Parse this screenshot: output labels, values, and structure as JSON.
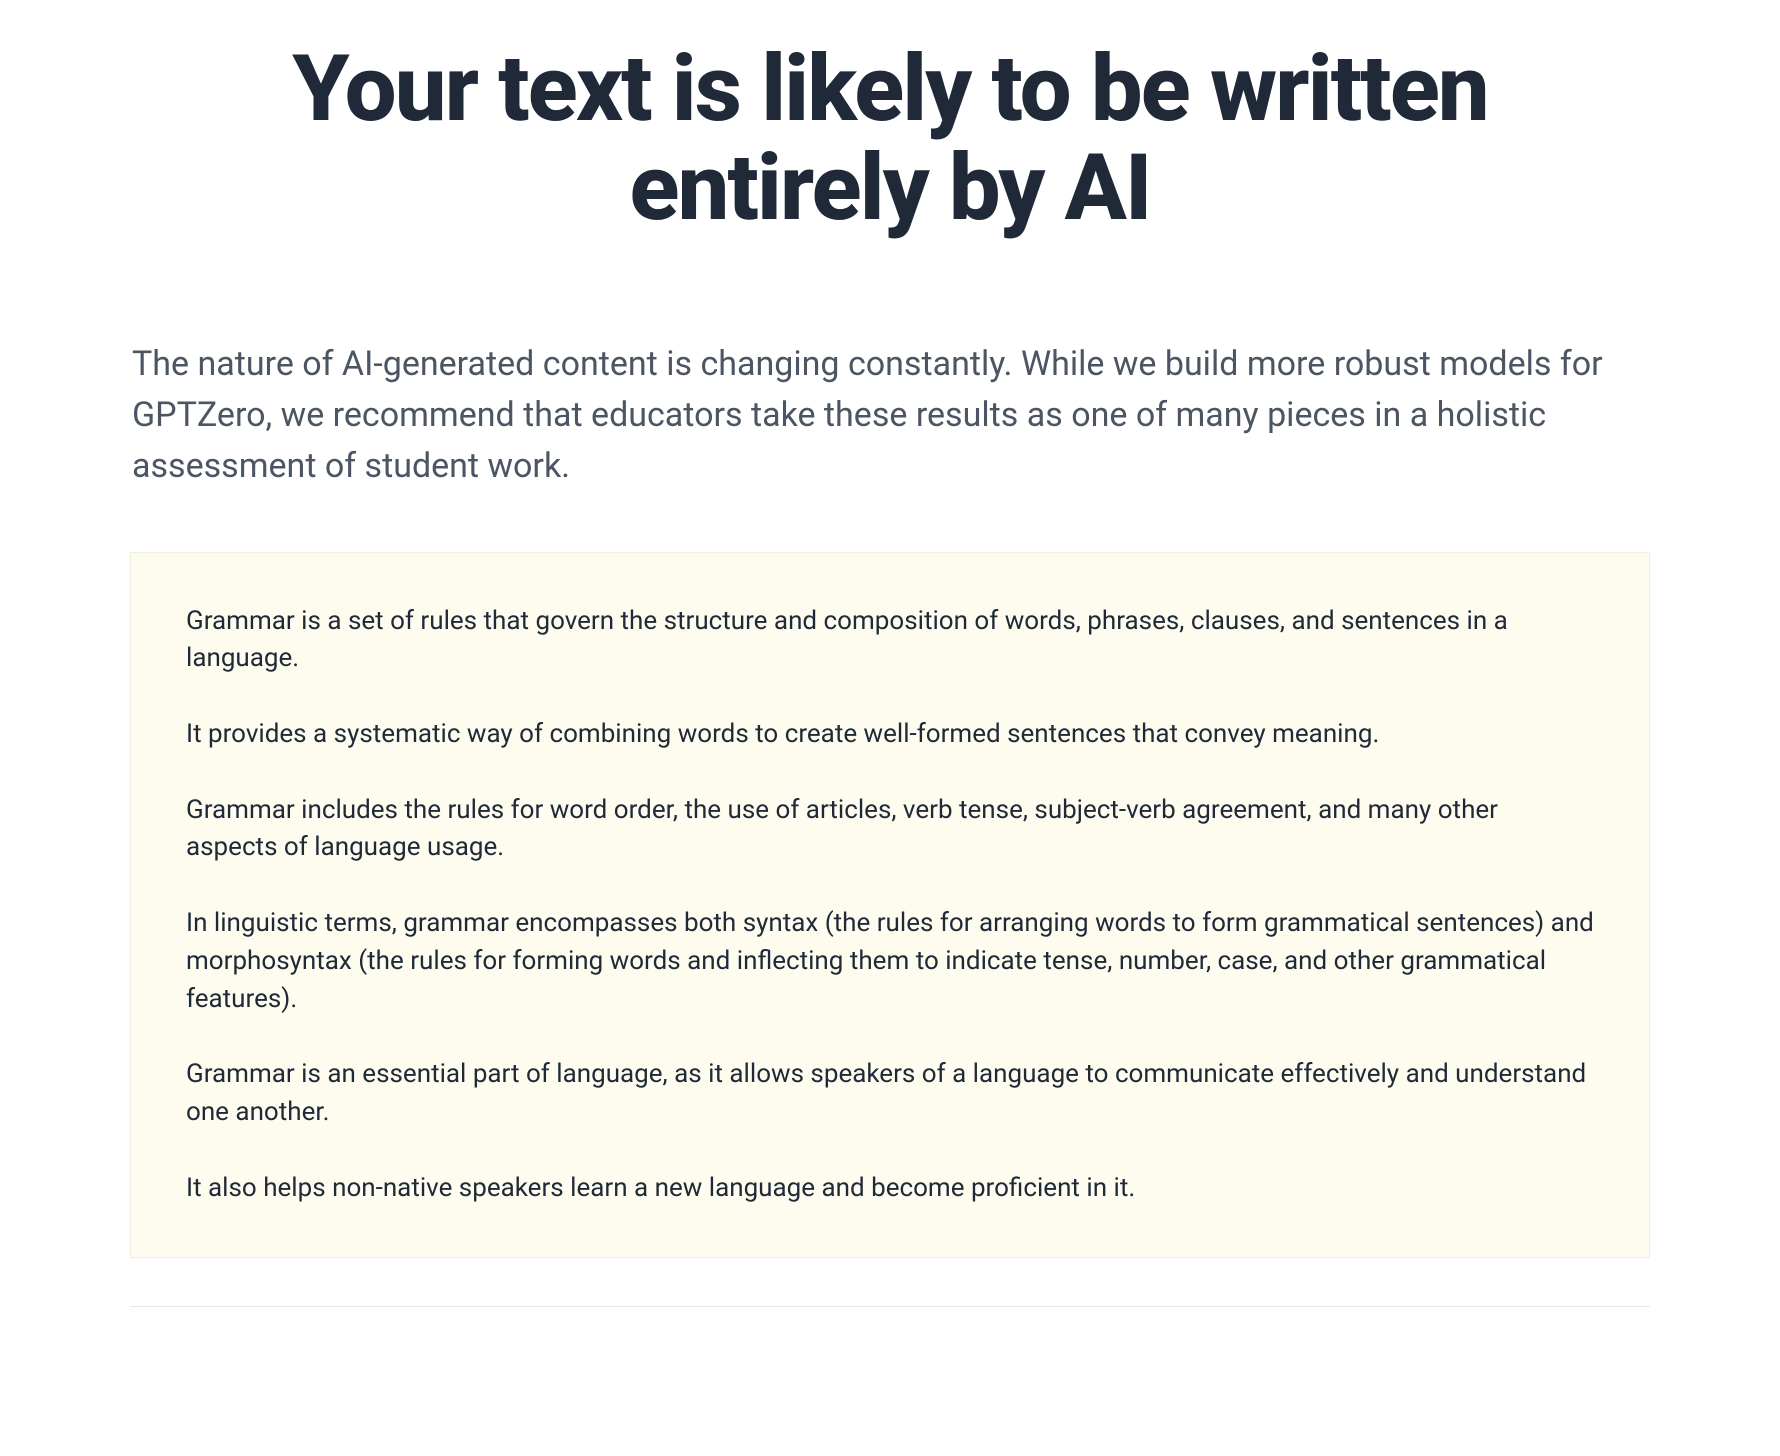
{
  "header": {
    "title": "Your text is likely to be written entirely by AI"
  },
  "subtitle": "The nature of AI-generated content is changing constantly. While we build more robust models for GPTZero, we recommend that educators take these results as one of many pieces in a holistic assessment of student work.",
  "content": {
    "paragraphs": [
      "Grammar is a set of rules that govern the structure and composition of words, phrases, clauses, and sentences in a language.",
      "It provides a systematic way of combining words to create well-formed sentences that convey meaning.",
      "Grammar includes the rules for word order, the use of articles, verb tense, subject-verb agreement, and many other aspects of language usage.",
      "In linguistic terms, grammar encompasses both syntax (the rules for arranging words to form grammatical sentences) and morphosyntax (the rules for forming words and inflecting them to indicate tense, number, case, and other grammatical features).",
      "Grammar is an essential part of language, as it allows speakers of a language to communicate effectively and understand one another.",
      "It also helps non-native speakers learn a new language and become proficient in it."
    ]
  }
}
